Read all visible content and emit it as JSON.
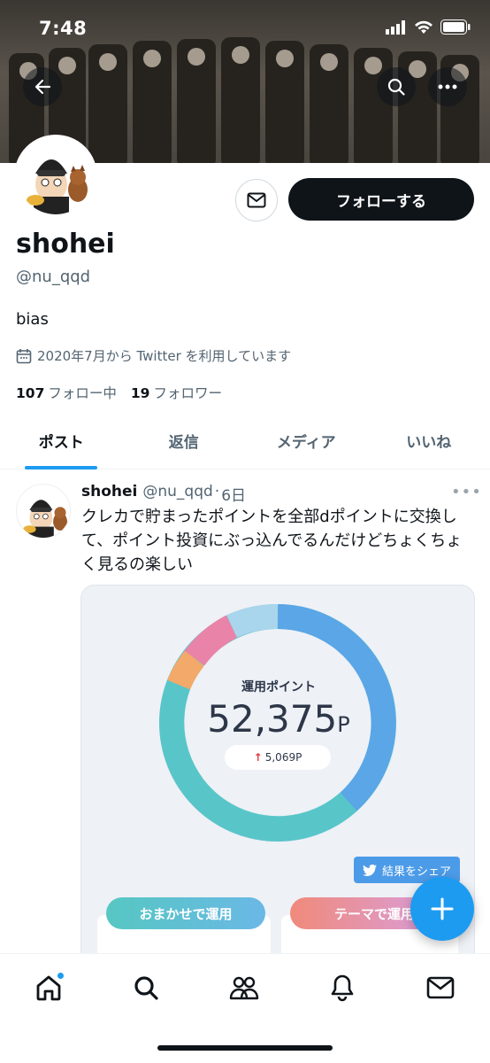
{
  "status_bar": {
    "time": "7:48"
  },
  "profile": {
    "name": "shohei",
    "handle": "@nu_qqd",
    "bio": "bias",
    "joined": "2020年7月から Twitter を利用しています",
    "following_count": "107",
    "following_label": "フォロー中",
    "followers_count": "19",
    "followers_label": "フォロワー",
    "follow_button": "フォローする"
  },
  "tabs": [
    {
      "label": "ポスト",
      "active": true
    },
    {
      "label": "返信"
    },
    {
      "label": "メディア"
    },
    {
      "label": "いいね"
    }
  ],
  "tweet": {
    "name": "shohei",
    "handle": "@nu_qqd",
    "separator": "·",
    "time": "6日",
    "text": "クレカで貯まったポイントを全部dポイントに交換して、ポイント投資にぶっ込んでるんだけどちょくちょく見るの楽しい",
    "card": {
      "title": "運用ポイント",
      "amount": "52,375",
      "unit": "P",
      "change": "5,069P",
      "share_label": "結果をシェア",
      "pill_left": "おまかせで運用",
      "pill_right": "テーマで運用"
    }
  },
  "icons": [
    "back-arrow-icon",
    "search-icon",
    "more-icon",
    "mail-icon",
    "calendar-icon",
    "home-icon",
    "explore-icon",
    "communities-icon",
    "bell-icon",
    "messages-icon",
    "compose-plus-icon"
  ]
}
